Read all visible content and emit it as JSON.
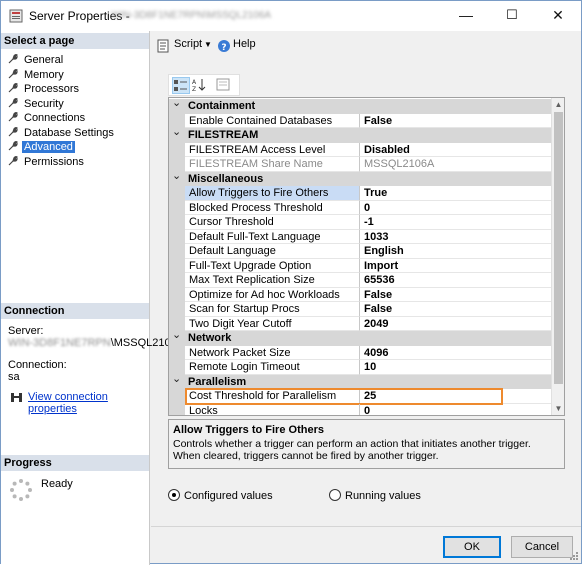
{
  "window": {
    "title": "Server Properties -",
    "server_name_blurred": "WIN-3D8F1NE7RPN\\MSSQL2106A",
    "minimize": "—",
    "maximize": "☐",
    "close": "✕"
  },
  "left_panel": {
    "select_page_header": "Select a page",
    "pages": [
      {
        "label": "General",
        "icon": "wrench-icon"
      },
      {
        "label": "Memory",
        "icon": "wrench-icon"
      },
      {
        "label": "Processors",
        "icon": "wrench-icon"
      },
      {
        "label": "Security",
        "icon": "wrench-icon"
      },
      {
        "label": "Connections",
        "icon": "wrench-icon"
      },
      {
        "label": "Database Settings",
        "icon": "wrench-icon"
      },
      {
        "label": "Advanced",
        "icon": "wrench-icon",
        "selected": true
      },
      {
        "label": "Permissions",
        "icon": "wrench-icon"
      }
    ],
    "connection_header": "Connection",
    "server_label": "Server:",
    "server_value_blurred": "WIN-3D8F1NE7RPN",
    "server_value_suffix": "\\MSSQL2106",
    "connection_label": "Connection:",
    "connection_value": "sa",
    "view_connection_link": "View connection properties",
    "progress_header": "Progress",
    "progress_status": "Ready"
  },
  "toolbar": {
    "script_label": "Script",
    "help_label": "Help"
  },
  "grid": {
    "rows": [
      {
        "type": "cat",
        "name": "Containment"
      },
      {
        "type": "prop",
        "name": "Enable Contained Databases",
        "value": "False"
      },
      {
        "type": "cat",
        "name": "FILESTREAM"
      },
      {
        "type": "prop",
        "name": "FILESTREAM Access Level",
        "value": "Disabled"
      },
      {
        "type": "prop",
        "name": "FILESTREAM Share Name",
        "value": "MSSQL2106A",
        "disabled": true
      },
      {
        "type": "cat",
        "name": "Miscellaneous"
      },
      {
        "type": "prop",
        "name": "Allow Triggers to Fire Others",
        "value": "True",
        "selected": true
      },
      {
        "type": "prop",
        "name": "Blocked Process Threshold",
        "value": "0"
      },
      {
        "type": "prop",
        "name": "Cursor Threshold",
        "value": "-1"
      },
      {
        "type": "prop",
        "name": "Default Full-Text Language",
        "value": "1033"
      },
      {
        "type": "prop",
        "name": "Default Language",
        "value": "English"
      },
      {
        "type": "prop",
        "name": "Full-Text Upgrade Option",
        "value": "Import"
      },
      {
        "type": "prop",
        "name": "Max Text Replication Size",
        "value": "65536"
      },
      {
        "type": "prop",
        "name": "Optimize for Ad hoc Workloads",
        "value": "False"
      },
      {
        "type": "prop",
        "name": "Scan for Startup Procs",
        "value": "False"
      },
      {
        "type": "prop",
        "name": "Two Digit Year Cutoff",
        "value": "2049"
      },
      {
        "type": "cat",
        "name": "Network"
      },
      {
        "type": "prop",
        "name": "Network Packet Size",
        "value": "4096"
      },
      {
        "type": "prop",
        "name": "Remote Login Timeout",
        "value": "10"
      },
      {
        "type": "cat",
        "name": "Parallelism"
      },
      {
        "type": "prop",
        "name": "Cost Threshold for Parallelism",
        "value": "25",
        "highlighted": true
      },
      {
        "type": "prop",
        "name": "Locks",
        "value": "0"
      }
    ]
  },
  "description": {
    "title": "Allow Triggers to Fire Others",
    "text": "Controls whether a trigger can perform an action that initiates another trigger. When cleared, triggers cannot be fired by another trigger."
  },
  "options": {
    "configured_label": "Configured values",
    "running_label": "Running values",
    "selected": "configured"
  },
  "buttons": {
    "ok": "OK",
    "cancel": "Cancel"
  },
  "colors": {
    "selection": "#3077d6",
    "highlight_border": "#ee8a2e",
    "link": "#0033cc"
  }
}
